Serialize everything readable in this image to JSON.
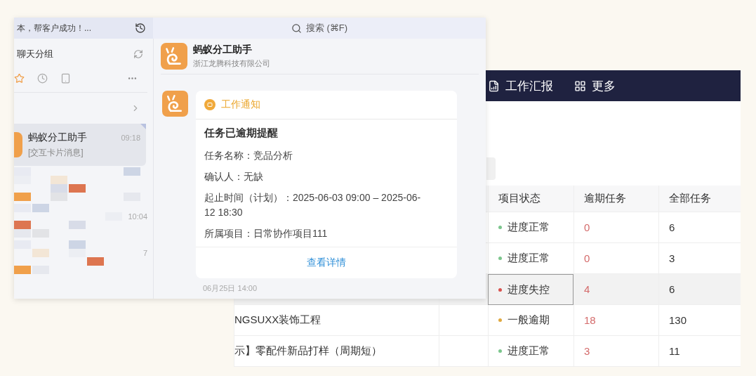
{
  "chat_window": {
    "banner_text": "本，帮客户成功！...",
    "search": {
      "placeholder": "搜索 (⌘F)"
    },
    "sidebar": {
      "title": "聊天分组",
      "chats": [
        {
          "kind": "visible",
          "name": "蚂蚁分工助手",
          "time": "09:18",
          "preview": "[交互卡片消息]",
          "selected": true
        },
        {
          "kind": "blurred",
          "selected": false
        },
        {
          "kind": "blurred",
          "time": "10:04",
          "selected": false
        },
        {
          "kind": "blurred",
          "time": "7",
          "selected": false
        }
      ]
    },
    "conversation": {
      "name": "蚂蚁分工助手",
      "company": "浙江龙腾科技有限公司",
      "card": {
        "tag": "工作通知",
        "title": "任务已逾期提醒",
        "fields": [
          "任务名称：竞品分析",
          "确认人：无缺",
          "起止时间（计划）：2025-06-03 09:00 – 2025-06-12 18:30",
          "所属项目：日常协作项目111"
        ],
        "action": "查看详情"
      },
      "timestamp": "06月25日 14:00"
    }
  },
  "project_window": {
    "nav": [
      {
        "label": "工作汇报"
      },
      {
        "label": "更多"
      }
    ],
    "table": {
      "columns": [
        "项目状态",
        "逾期任务",
        "全部任务"
      ],
      "rows": [
        {
          "status": "进度正常",
          "color": "#7cc68d",
          "overdue": "0",
          "total": "6",
          "selected": false
        },
        {
          "status": "进度正常",
          "color": "#7cc68d",
          "overdue": "0",
          "total": "3",
          "selected": false
        },
        {
          "status": "进度失控",
          "color": "#d9534f",
          "overdue": "4",
          "total": "6",
          "selected": true
        },
        {
          "project": "NGSUXX装饰工程",
          "status": "一般逾期",
          "color": "#e0a940",
          "overdue": "18",
          "total": "130",
          "selected": false
        },
        {
          "project": "示】零配件新品打样（周期短）",
          "status": "进度正常",
          "color": "#7cc68d",
          "overdue": "3",
          "total": "11",
          "selected": false
        }
      ]
    }
  }
}
